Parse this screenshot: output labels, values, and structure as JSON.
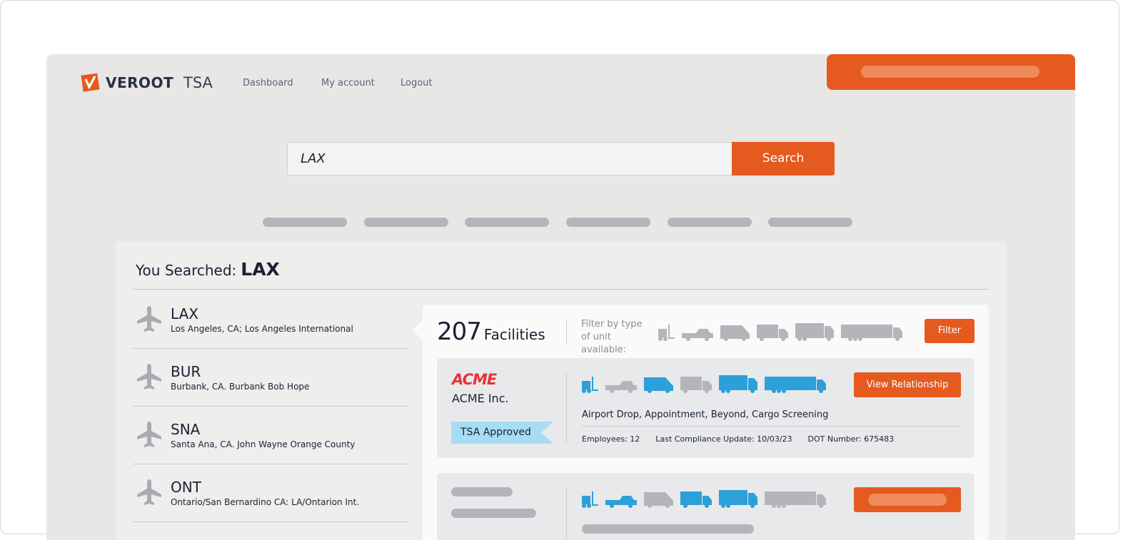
{
  "header": {
    "logo": "VEROOT",
    "product": "TSA",
    "nav": [
      "Dashboard",
      "My account",
      "Logout"
    ]
  },
  "search": {
    "value": "LAX",
    "button": "Search"
  },
  "results": {
    "label": "You Searched:",
    "query": "LAX",
    "airports": [
      {
        "code": "LAX",
        "name": "Los Angeles, CA; Los Angeles International"
      },
      {
        "code": "BUR",
        "name": "Burbank, CA. Burbank Bob Hope"
      },
      {
        "code": "SNA",
        "name": "Santa Ana, CA. John Wayne Orange County"
      },
      {
        "code": "ONT",
        "name": "Ontario/San Bernardino CA: LA/Ontarion Int."
      }
    ],
    "facilities_count": "207",
    "facilities_label": "Facilities",
    "filter_label": "Filter by type of unit available:",
    "filter_button": "Filter",
    "unit_types": [
      "forklift",
      "pickup",
      "van",
      "box-truck",
      "semi-truck",
      "tractor-trailer"
    ],
    "cards": [
      {
        "logo": "ACME",
        "name": "ACME Inc.",
        "badge": "TSA Approved",
        "button": "View Relationship",
        "available": [
          true,
          false,
          true,
          false,
          true,
          true
        ],
        "services": "Airport Drop, Appointment, Beyond, Cargo Screening",
        "employees": "Employees: 12",
        "compliance": "Last Compliance Update: 10/03/23",
        "dot": "DOT Number: 675483"
      },
      {
        "available": [
          true,
          true,
          false,
          true,
          true,
          false
        ]
      }
    ]
  },
  "colors": {
    "accent": "#e55a1f",
    "available": "#2d9fd9",
    "unavailable": "#b4b5ba",
    "badge": "#a7dcf5"
  }
}
